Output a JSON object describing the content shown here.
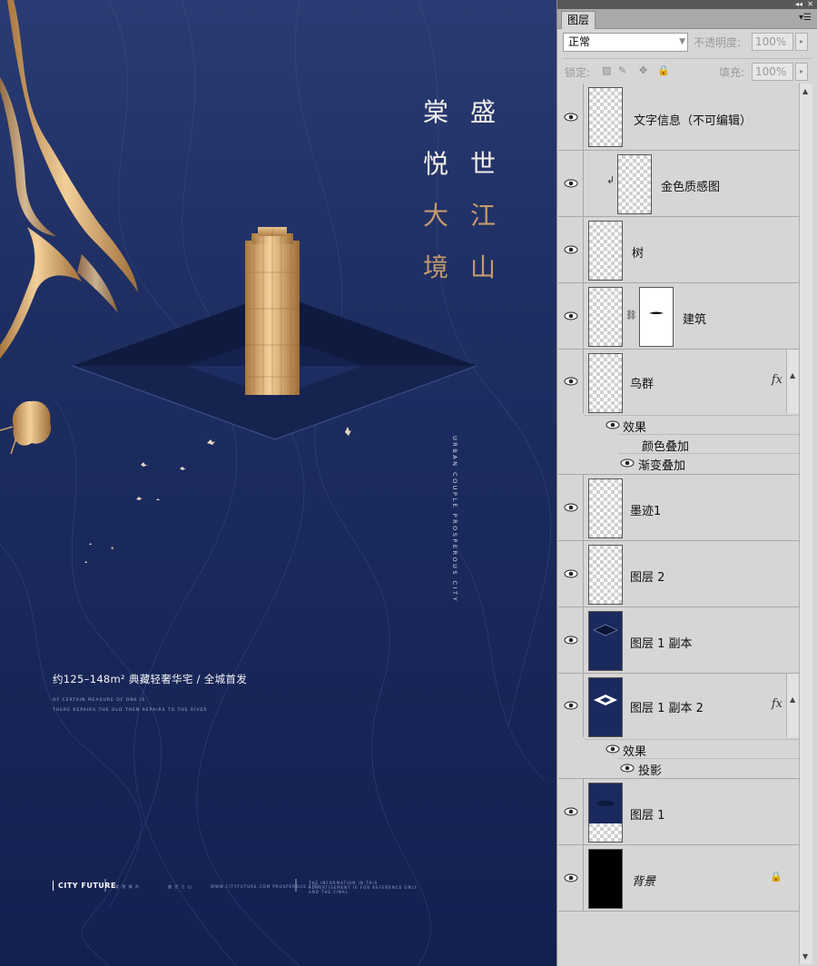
{
  "poster": {
    "title_right": [
      "盛",
      "世",
      "江",
      "山"
    ],
    "title_left": [
      "棠",
      "悦",
      "大",
      "境"
    ],
    "vertical_english": "URBAN COUPLE PROSPEROUS CITY",
    "headline": "约125–148m² 典藏轻奢华宅 / 全城首发",
    "subline_1": "OF CERTAIN MEASURE OF ONE IS",
    "subline_2": "THERE REPAIRS THE OLD THEN REPAIRS TO THE RIVER",
    "footer_brand": "CITY FUTURE",
    "footer_small_1": "棠 悦 城 市",
    "footer_small_2": "盛 世 江 山",
    "footer_small_3": "WWW.CITYFUTURE.COM  PROSPEROUS CITY",
    "footer_small_4": "THE INFORMATION IN THIS ADVERTISEMENT IS FOR REFERENCE ONLY AND THE FINAL"
  },
  "panel": {
    "tab_label": "图层",
    "blend_mode": "正常",
    "opacity_label": "不透明度:",
    "opacity_value": "100%",
    "lock_label": "锁定:",
    "fill_label": "填充:",
    "fill_value": "100%",
    "fx_label": "fx",
    "layers": [
      {
        "name": "文字信息（不可编辑）",
        "thumb": "checker"
      },
      {
        "name": "金色质感图",
        "thumb": "checker",
        "clipped": true
      },
      {
        "name": "树",
        "thumb": "checker"
      },
      {
        "name": "建筑",
        "thumb": "checker",
        "mask": true
      },
      {
        "name": "鸟群",
        "thumb": "checker",
        "fx": true,
        "effects_label": "效果",
        "effects": [
          "颜色叠加",
          "渐变叠加"
        ]
      },
      {
        "name": "墨迹1",
        "thumb": "checker"
      },
      {
        "name": "图层 2",
        "thumb": "checker"
      },
      {
        "name": "图层 1 副本",
        "thumb": "navy"
      },
      {
        "name": "图层 1 副本 2",
        "thumb": "navy",
        "fx": true,
        "effects_label": "效果",
        "effects": [
          "投影"
        ]
      },
      {
        "name": "图层 1",
        "thumb": "navy-checker"
      },
      {
        "name": "背景",
        "thumb": "black",
        "locked": true
      }
    ]
  },
  "colors": {
    "poster_bg": "#1f2f63",
    "gold": "#c49a6c",
    "panel_bg": "#d6d6d6"
  }
}
